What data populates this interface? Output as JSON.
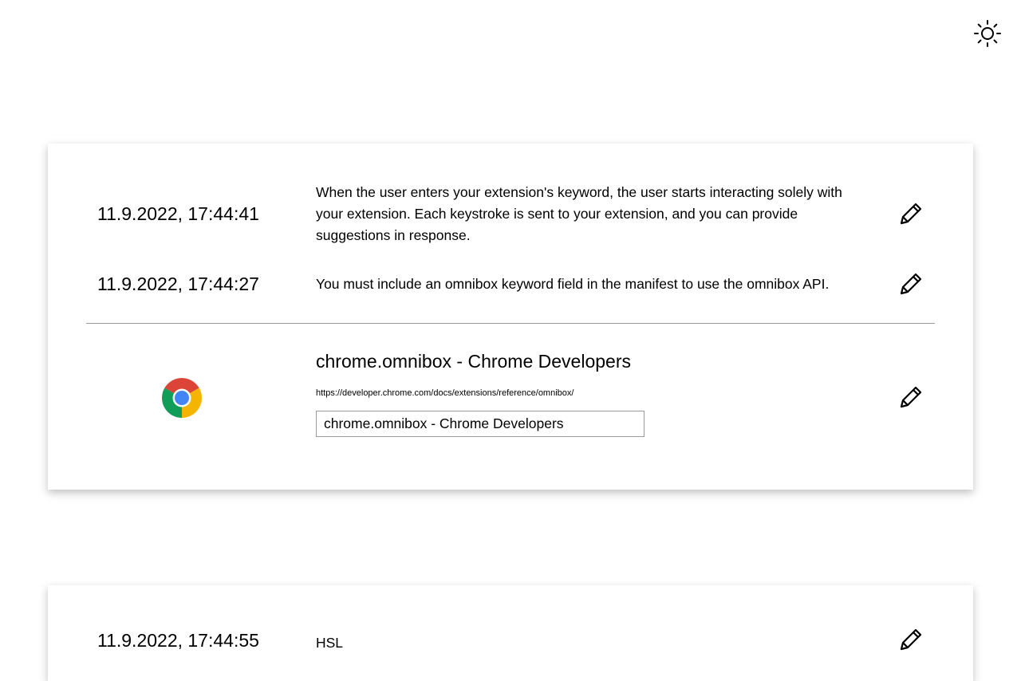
{
  "header": {
    "theme_toggle_icon": "sun-icon"
  },
  "cards": [
    {
      "notes": [
        {
          "timestamp": "11.9.2022, 17:44:41",
          "text": "When the user enters your extension's keyword, the user starts interacting solely with your extension. Each keystroke is sent to your extension, and you can provide suggestions in response.",
          "edit_icon": "pencil-icon"
        },
        {
          "timestamp": "11.9.2022, 17:44:27",
          "text": "You must include an omnibox keyword field in the manifest to use the omnibox API.",
          "edit_icon": "pencil-icon"
        }
      ],
      "page": {
        "favicon": "chrome-logo-icon",
        "title": "chrome.omnibox - Chrome Developers",
        "url": "https://developer.chrome.com/docs/extensions/reference/omnibox/",
        "title_input_value": "chrome.omnibox - Chrome Developers",
        "edit_icon": "pencil-icon"
      }
    },
    {
      "notes": [
        {
          "timestamp": "11.9.2022, 17:44:55",
          "text": "HSL",
          "edit_icon": "pencil-icon"
        }
      ]
    }
  ]
}
